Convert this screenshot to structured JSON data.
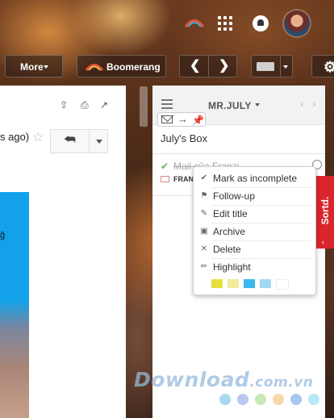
{
  "toolbar": {
    "more_label": "More",
    "boomerang_label": "Boomerang"
  },
  "email": {
    "time_ago": "s ago)"
  },
  "sortd": {
    "board_title": "MR.JULY",
    "box_title": "July's Box",
    "task": {
      "subject": "Mail của Franzi",
      "from": "FRAN"
    },
    "tab_label": "Sortd."
  },
  "context_menu": {
    "items": [
      {
        "label": "Mark as incomplete",
        "icon": "check-icon"
      },
      {
        "label": "Follow-up",
        "icon": "flag-icon"
      },
      {
        "label": "Edit title",
        "icon": "pencil-icon"
      },
      {
        "label": "Archive",
        "icon": "archive-icon"
      },
      {
        "label": "Delete",
        "icon": "x-icon"
      },
      {
        "label": "Highlight",
        "icon": "highlighter-icon"
      }
    ],
    "highlight_colors": [
      "#e6e03c",
      "#f0ec9a",
      "#3cb8ee",
      "#a2d8f2",
      "#ffffff"
    ]
  },
  "watermark": {
    "brand": "Download",
    "domain": ".com.vn",
    "dot_colors": [
      "#a8d8f0",
      "#b8c8f0",
      "#c8e8b8",
      "#f8d8a8",
      "#a8c8f0",
      "#b8e8f8"
    ]
  }
}
